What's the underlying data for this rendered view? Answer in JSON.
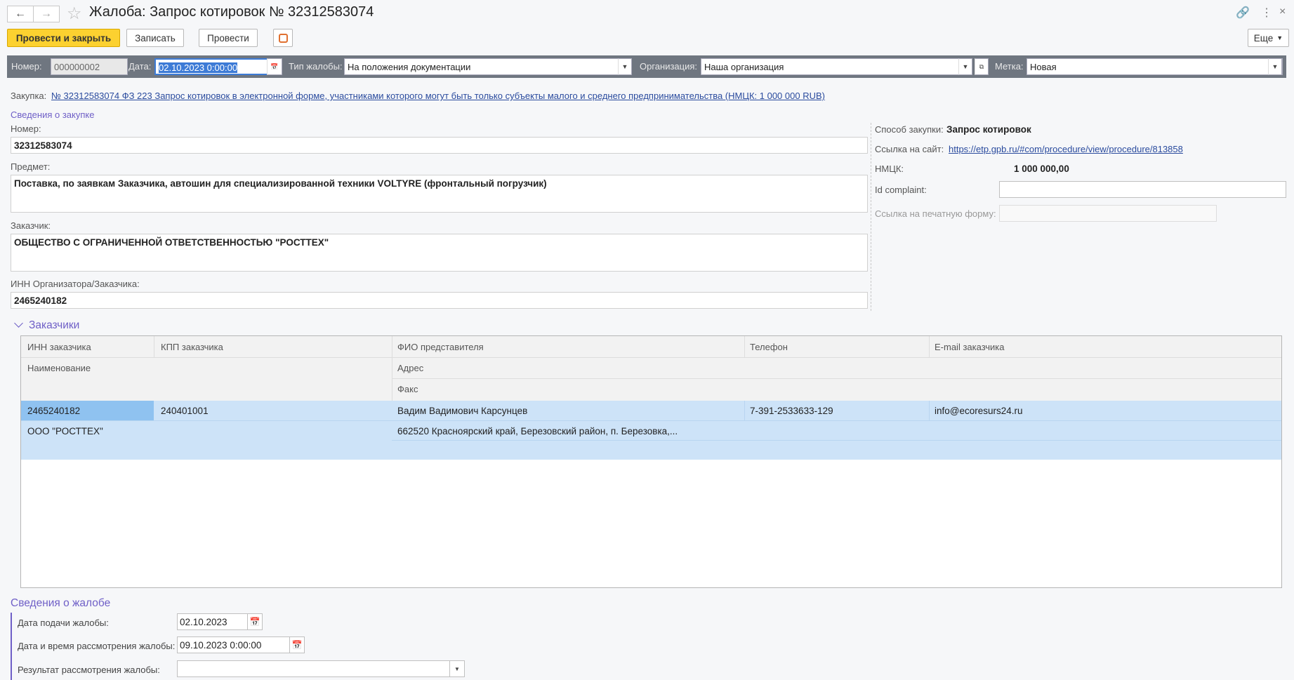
{
  "window": {
    "title": "Жалоба: Запрос котировок № 32312583074"
  },
  "toolbar": {
    "post_close": "Провести и закрыть",
    "save": "Записать",
    "post": "Провести",
    "more": "Еще"
  },
  "header": {
    "number_label": "Номер:",
    "number_value": "000000002",
    "date_label": "Дата:",
    "date_value": "02.10.2023  0:00:00",
    "type_label": "Тип жалобы:",
    "type_value": "На положения документации",
    "org_label": "Организация:",
    "org_value": "Наша организация",
    "mark_label": "Метка:",
    "mark_value": "Новая"
  },
  "purchase": {
    "label": "Закупка:",
    "link": "№ 32312583074 ФЗ 223 Запрос котировок в электронной форме, участниками которого могут быть только субъекты малого и среднего предпринимательства (НМЦК: 1 000 000 RUB)"
  },
  "info": {
    "section_title": "Сведения о закупке",
    "number_label": "Номер:",
    "number_value": "32312583074",
    "subject_label": "Предмет:",
    "subject_value": "Поставка, по заявкам Заказчика, автошин для специализированной техники VOLTYRE (фронтальный погрузчик)",
    "customer_label": "Заказчик:",
    "customer_value": "ОБЩЕСТВО С ОГРАНИЧЕННОЙ ОТВЕТСТВЕННОСТЬЮ \"РОСТТЕХ\"",
    "inn_label": "ИНН Организатора/Заказчика:",
    "inn_value": "2465240182",
    "method_label": "Способ закупки:",
    "method_value": "Запрос котировок",
    "site_label": "Ссылка на сайт:",
    "site_value": "https://etp.gpb.ru/#com/procedure/view/procedure/813858",
    "nmck_label": "НМЦК:",
    "nmck_value": "1 000 000,00",
    "complaint_id_label": "Id complaint:",
    "complaint_id_value": "",
    "print_form_label": "Ссылка на печатную форму:",
    "print_form_value": ""
  },
  "customers": {
    "section_title": "Заказчики",
    "columns": {
      "inn": "ИНН заказчика",
      "kpp": "КПП заказчика",
      "fio": "ФИО представителя",
      "phone": "Телефон",
      "email": "E-mail заказчика",
      "name": "Наименование",
      "address": "Адрес",
      "fax": "Факс"
    },
    "rows": [
      {
        "inn": "2465240182",
        "kpp": "240401001",
        "fio": "Вадим Вадимович Карсунцев",
        "phone": "7-391-2533633-129",
        "email": "info@ecoresurs24.ru",
        "name": "ООО \"РОСТТЕХ\"",
        "address": "662520 Красноярский край, Березовский район, п. Березовка,...",
        "fax": ""
      }
    ]
  },
  "complaint": {
    "section_title": "Сведения о жалобе",
    "filed_label": "Дата подачи жалобы:",
    "filed_value": "02.10.2023",
    "review_label": "Дата и время рассмотрения жалобы:",
    "review_value": "09.10.2023  0:00:00",
    "result_label": "Результат рассмотрения жалобы:",
    "result_value": ""
  },
  "colors": {
    "accent_button": "#fcd130",
    "header_band": "#6f7680",
    "section": "#6f5fc7",
    "selected_row": "#cde3f8",
    "selected_cell": "#8fc2f0"
  }
}
